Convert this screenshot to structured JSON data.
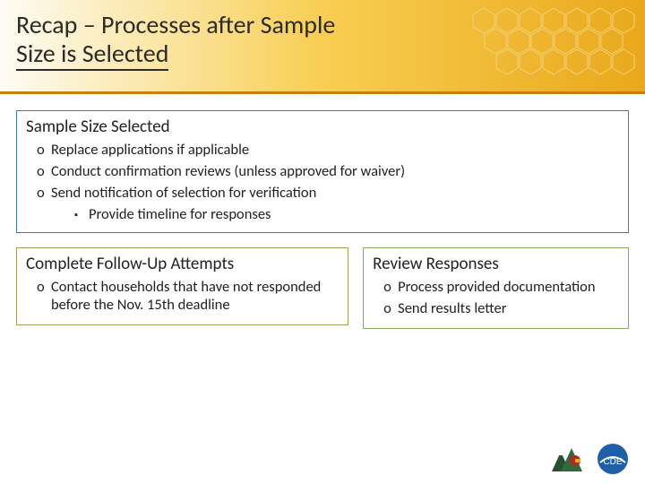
{
  "header": {
    "title_line1": "Recap – Processes after Sample",
    "title_line2": "Size is Selected"
  },
  "boxes": {
    "sample_size": {
      "title": "Sample Size Selected",
      "items": [
        "Replace applications if applicable",
        "Conduct confirmation reviews (unless approved for waiver)",
        "Send notification of selection for verification"
      ],
      "subitems": [
        "Provide timeline for responses"
      ]
    },
    "follow_up": {
      "title": "Complete Follow-Up Attempts",
      "items": [
        "Contact households that have not responded before the Nov. 15th deadline"
      ]
    },
    "review": {
      "title": "Review Responses",
      "items": [
        "Process provided documentation",
        "Send results letter"
      ]
    }
  },
  "logos": {
    "colorado": "Colorado",
    "cde": "CDE"
  },
  "colors": {
    "accent_orange": "#e9a81b",
    "blue": "#4779b8",
    "olive": "#a4a15a",
    "green": "#8cae5f"
  }
}
